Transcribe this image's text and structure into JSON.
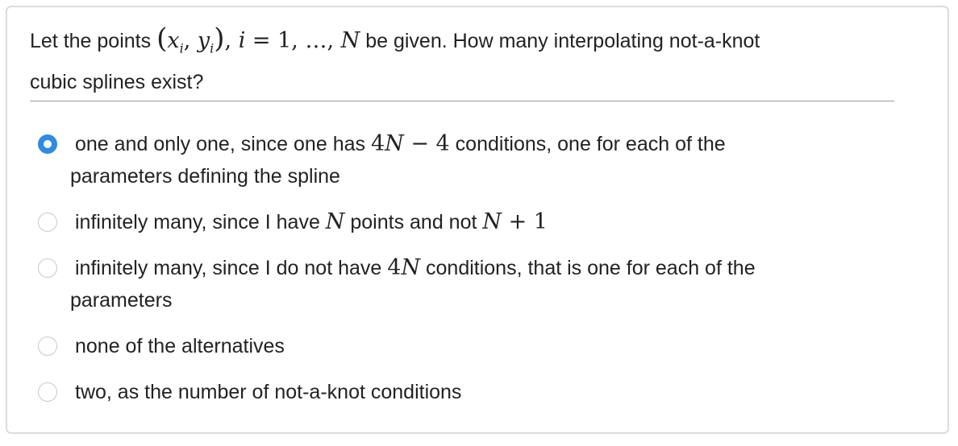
{
  "question": {
    "prefix": "Let the points",
    "math_points": "(x",
    "sub_i": "i",
    "comma_y": ", y",
    "sub_i2": "i",
    "close": ")",
    "math_range": ", i = 1, …, ",
    "math_N": "N",
    "suffix_line1": " be given. How many interpolating not-a-knot",
    "line2": "cubic splines exist?"
  },
  "options": [
    {
      "checked": true,
      "part1": "one and only one, since one has ",
      "math": "4N − 4",
      "part2": " conditions, one for each of the",
      "line2": "parameters defining the spline"
    },
    {
      "checked": false,
      "part1": "infinitely many, since I have ",
      "math": "N",
      "part2": " points and not ",
      "math2": "N + 1"
    },
    {
      "checked": false,
      "part1": "infinitely many, since I do not have ",
      "math": "4N",
      "part2": " conditions, that is one for each of the",
      "line2": "parameters"
    },
    {
      "checked": false,
      "part1": "none of the alternatives"
    },
    {
      "checked": false,
      "part1": "two, as the number of not-a-knot conditions"
    }
  ]
}
